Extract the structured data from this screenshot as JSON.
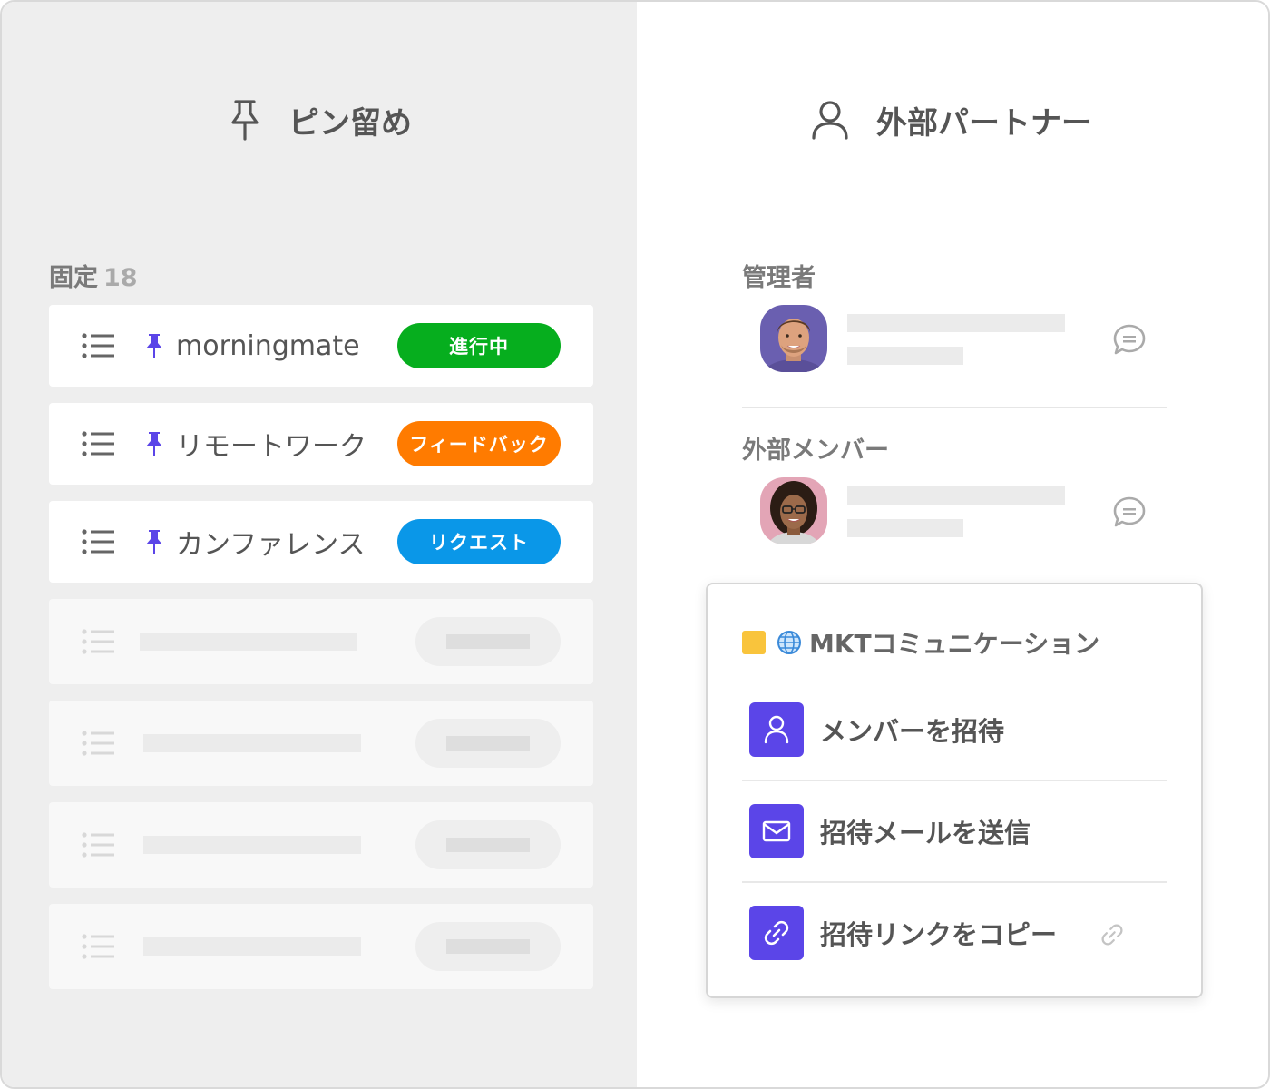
{
  "pinned_panel": {
    "title": "ピン留め",
    "section_label": "固定",
    "section_count": "18",
    "items": [
      {
        "title": "morningmate",
        "badge": "進行中",
        "badge_color": "#06ae1e"
      },
      {
        "title": "リモートワーク",
        "badge": "フィードバック",
        "badge_color": "#ff7b00"
      },
      {
        "title": "カンファレンス",
        "badge": "リクエスト",
        "badge_color": "#0a97e8"
      }
    ],
    "placeholder_rows": 4
  },
  "partners_panel": {
    "title": "外部パートナー",
    "admin_label": "管理者",
    "external_label": "外部メンバー"
  },
  "popup": {
    "project_name": "MKTコミュニケーション",
    "project_color": "#f9c43c",
    "actions": [
      {
        "label": "メンバーを招待",
        "icon": "user-icon"
      },
      {
        "label": "招待メールを送信",
        "icon": "mail-icon"
      },
      {
        "label": "招待リンクをコピー",
        "icon": "link-icon"
      }
    ]
  },
  "colors": {
    "accent": "#5b45e8",
    "panel_bg": "#eeeeee"
  }
}
